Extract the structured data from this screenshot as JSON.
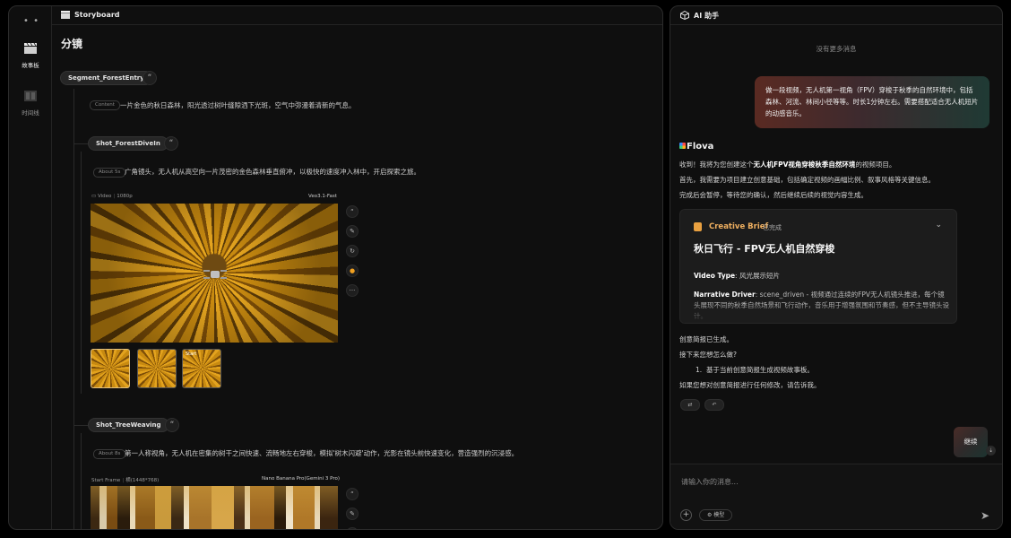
{
  "rail": {
    "menu_icon": "•  •",
    "items": [
      {
        "label": "故事板",
        "icon": "clapperboard-icon"
      },
      {
        "label": "时间线",
        "icon": "timeline-icon"
      }
    ]
  },
  "header": {
    "title": "Storyboard"
  },
  "main": {
    "page_title": "分镜",
    "quote_glyph": "“",
    "segment": {
      "name": "Segment_ForestEntry",
      "content_tag": "Content",
      "content_text": "一片金色的秋日森林，阳光透过树叶缝隙洒下光斑，空气中弥漫着清新的气息。"
    },
    "shots": [
      {
        "name": "Shot_ForestDiveIn",
        "duration_tag": "About 5s",
        "description": "广角镜头，无人机从高空向一片茂密的金色森林垂直俯冲，以极快的速度冲入林中，开启探索之旅。",
        "media_type": "Video",
        "media_res": "1080p",
        "model": "Veo3.1-Fast",
        "thumbs": [
          {
            "label": ""
          },
          {
            "label": ""
          },
          {
            "label": "Start"
          }
        ]
      },
      {
        "name": "Shot_TreeWeaving",
        "duration_tag": "About 8s",
        "description": "第一人称视角，无人机在密集的树干之间快速、流畅地左右穿梭，模拟'树木闪避'动作，光影在镜头前快速变化，营造强烈的沉浸感。",
        "media_type": "Start Frame",
        "media_res": "横(1448*768)",
        "model": "Nano Banana Pro(Gemini 3 Pro)"
      }
    ],
    "tools": [
      "“",
      "✎",
      "↻",
      "●",
      "···"
    ]
  },
  "assistant": {
    "title": "AI 助手",
    "no_more": "没有更多消息",
    "user_message": "做一段视频，无人机第一视角（FPV）穿梭于秋季的自然环境中，包括森林、河流、林间小径等等。时长1分钟左右。需要搭配适合无人机短片的动感音乐。",
    "bot_name": "Flova",
    "msg1_pre": "收到！我将为您创建这个",
    "msg1_bold": "无人机FPV视角穿梭秋季自然环境",
    "msg1_post": "的视频项目。",
    "msg2": "首先，我需要为项目建立创意基础，包括确定视频的画幅比例、叙事风格等关键信息。",
    "msg3": "完成后会暂停，等待您的确认，然后继续后续的视觉内容生成。",
    "brief": {
      "title": "Creative Brief",
      "status": "已完成",
      "chevron": "⌄",
      "heading": "秋日飞行 - FPV无人机自然穿梭",
      "video_type_label": "Video Type",
      "video_type_value": ": 风光展示短片",
      "narrative_label": "Narrative Driver",
      "narrative_value": ": scene_driven - 视频通过连续的FPV无人机镜头推进，每个镜头展现不同的秋季自然场景和飞行动作，音乐用于增强氛围和节奏感，但不主导镜头设计。"
    },
    "msg4": "创意简报已生成。",
    "msg5": "接下来您想怎么做?",
    "list_item_num": "1.",
    "list_item": "基于当前创意简报生成视频故事板。",
    "msg6": "如果您想对创意简报进行任何修改，请告诉我。",
    "share_glyph": "⇄",
    "undo_glyph": "↶",
    "continue_label": "继续",
    "scroll_glyph": "⇣",
    "input_placeholder": "请输入你的消息...",
    "plus_glyph": "+",
    "model_label": "模型",
    "send_glyph": "➤"
  },
  "colors": {
    "accent_orange": "#f0b060",
    "panel_bg": "#0f0f0f",
    "border": "#2c2c2c"
  }
}
